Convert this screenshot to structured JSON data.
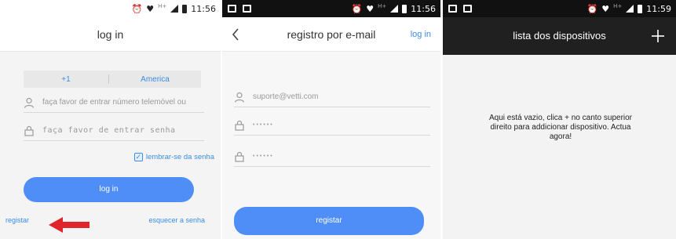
{
  "screens": [
    {
      "status": {
        "time": "11:56",
        "network": "H+"
      },
      "title": "log in",
      "country_code": "+1",
      "country": "America",
      "phone_placeholder": "faça favor de entrar número telemóvel ou",
      "password_placeholder": "faça favor de entrar senha",
      "remember_label": "lembrar-se da senha",
      "login_button": "log in",
      "register_link": "registar",
      "forgot_link": "esquecer a senha",
      "icons": [
        "user-icon",
        "lock-icon",
        "checkbox-checked-icon",
        "red-arrow-icon"
      ]
    },
    {
      "status": {
        "time": "11:56",
        "network": "H+"
      },
      "title": "registro por e-mail",
      "top_link": "log in",
      "email_value": "suporte@vetti.com",
      "password_mask": "••••••",
      "confirm_mask": "••••••",
      "register_button": "registar",
      "icons": [
        "back-arrow-icon",
        "user-icon",
        "lock-icon",
        "lock-icon"
      ]
    },
    {
      "status": {
        "time": "11:59",
        "network": "H+"
      },
      "title": "lista dos dispositivos",
      "empty_message": "Aqui está vazio, clica + no canto superior direito para addicionar dispositivo. Actua agora!",
      "icons": [
        "plus-icon"
      ]
    }
  ],
  "colors": {
    "accent": "#4f8ef7",
    "link": "#3a8ce6",
    "dark_bar": "#202020",
    "arrow": "#e0252a"
  }
}
